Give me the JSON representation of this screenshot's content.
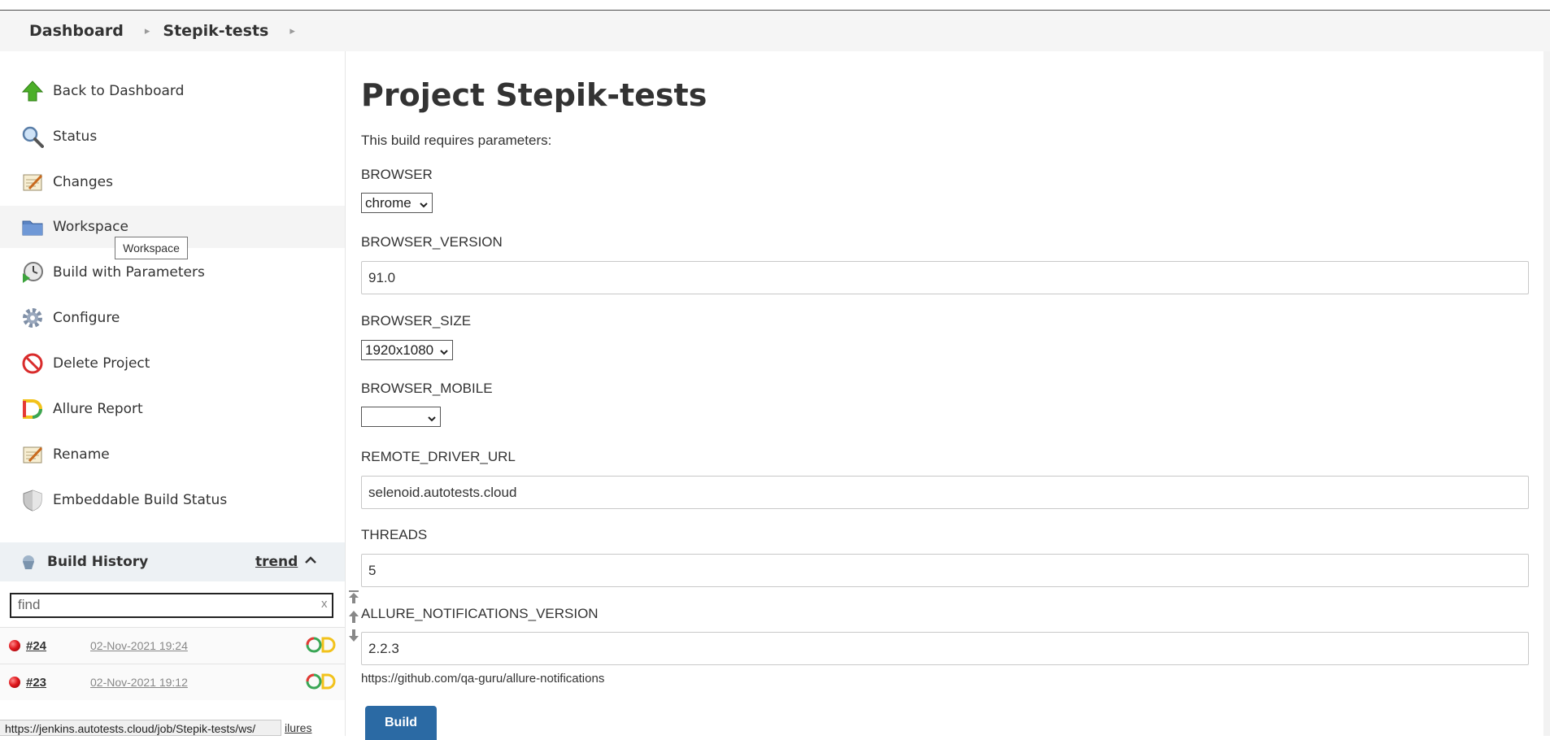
{
  "breadcrumb": {
    "items": [
      "Dashboard",
      "Stepik-tests"
    ]
  },
  "sidebar": {
    "tasks": [
      {
        "label": "Back to Dashboard",
        "icon": "up-arrow-icon"
      },
      {
        "label": "Status",
        "icon": "magnifier-icon"
      },
      {
        "label": "Changes",
        "icon": "notepad-icon"
      },
      {
        "label": "Workspace",
        "icon": "folder-icon"
      },
      {
        "label": "Build with Parameters",
        "icon": "clock-play-icon"
      },
      {
        "label": "Configure",
        "icon": "gear-icon"
      },
      {
        "label": "Delete Project",
        "icon": "no-entry-icon"
      },
      {
        "label": "Allure Report",
        "icon": "allure-icon"
      },
      {
        "label": "Rename",
        "icon": "notepad-icon"
      },
      {
        "label": "Embeddable Build Status",
        "icon": "shield-icon"
      }
    ],
    "tooltip": "Workspace"
  },
  "build_history": {
    "title": "Build History",
    "trend_label": "trend",
    "search_placeholder": "find",
    "clear_label": "x",
    "builds": [
      {
        "number": "#24",
        "date": "02-Nov-2021 19:24",
        "status_color": "#e0191e"
      },
      {
        "number": "#23",
        "date": "02-Nov-2021 19:12",
        "status_color": "#e0191e"
      }
    ]
  },
  "status_bar": {
    "url": "https://jenkins.autotests.cloud/job/Stepik-tests/ws/",
    "peek_text": "ilures"
  },
  "main": {
    "title": "Project Stepik-tests",
    "intro": "This build requires parameters:",
    "params": {
      "browser": {
        "label": "BROWSER",
        "value": "chrome"
      },
      "browser_version": {
        "label": "BROWSER_VERSION",
        "value": "91.0"
      },
      "browser_size": {
        "label": "BROWSER_SIZE",
        "value": "1920x1080"
      },
      "browser_mobile": {
        "label": "BROWSER_MOBILE",
        "value": ""
      },
      "remote_driver_url": {
        "label": "REMOTE_DRIVER_URL",
        "value": "selenoid.autotests.cloud"
      },
      "threads": {
        "label": "THREADS",
        "value": "5"
      },
      "allure_notifications_version": {
        "label": "ALLURE_NOTIFICATIONS_VERSION",
        "value": "2.2.3",
        "description": "https://github.com/qa-guru/allure-notifications"
      }
    },
    "build_button": "Build"
  },
  "colors": {
    "primary_button": "#2b6aa4",
    "breadcrumb_bg": "#f5f5f5",
    "build_history_header_bg": "#edf1f4",
    "failed_build": "#e0191e"
  }
}
